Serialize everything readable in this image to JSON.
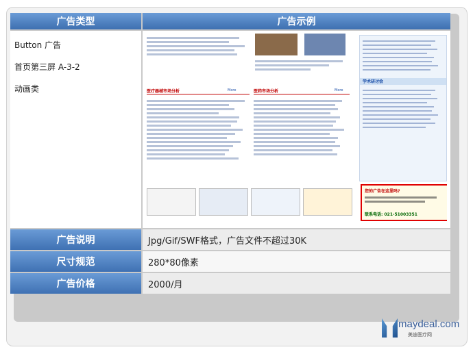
{
  "table": {
    "header_type": "广告类型",
    "header_example": "广告示例",
    "type_lines": [
      "Button 广告",
      "首页第三屏  A-3-2",
      "动画类"
    ],
    "rows": [
      {
        "label": "广告说明",
        "value": "Jpg/Gif/SWF格式，广告文件不超过30K"
      },
      {
        "label": "尺寸规范",
        "value": "280*80像素"
      },
      {
        "label": "广告价格",
        "value": "2000/月"
      }
    ]
  },
  "sample": {
    "section_left": "医疗器械市场分析",
    "section_mid": "医药市场分析",
    "more": "More",
    "side_title": "学术研讨会",
    "hilite_title": "您的广告在这里吗?",
    "hilite_phone": "联系电话: 021-51003351"
  },
  "brand": {
    "name": "maydeal.com",
    "sub": "美迪医疗网"
  }
}
